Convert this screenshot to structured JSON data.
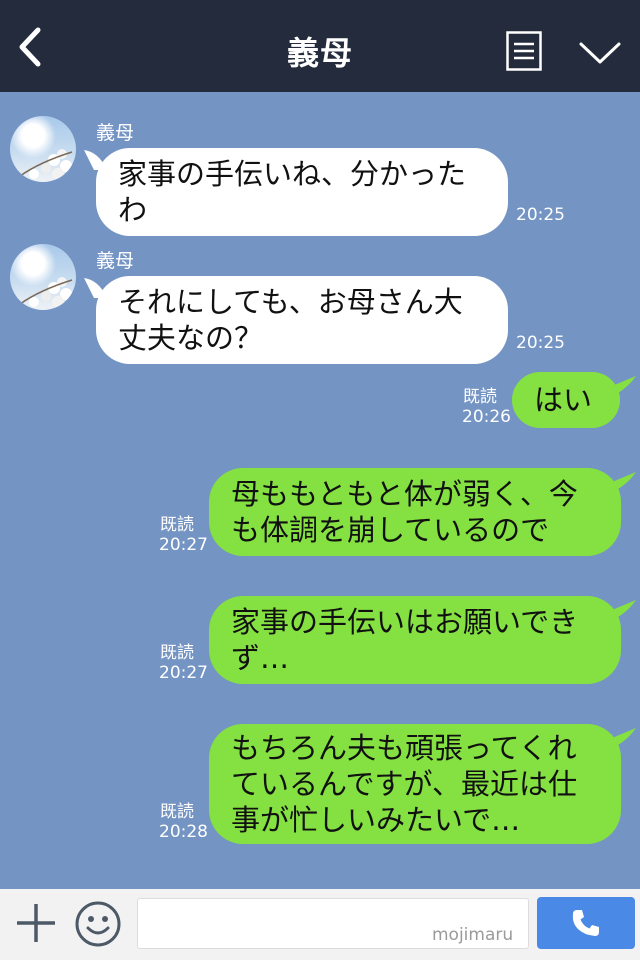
{
  "header": {
    "title": "義母",
    "back_icon": "chevron-left-icon",
    "menu_icon": "list-icon",
    "expand_icon": "chevron-down-icon",
    "background": "#232b3d"
  },
  "chat": {
    "background": "#7494c4",
    "messages": [
      {
        "direction": "in",
        "sender": "義母",
        "text": "家事の手伝いね、分かった\nわ",
        "time": "20:25"
      },
      {
        "direction": "in",
        "sender": "義母",
        "text": "それにしても、お母さん大\n丈夫なの？",
        "time": "20:25"
      },
      {
        "direction": "out",
        "read": "既読",
        "text": "はい",
        "time": "20:26"
      },
      {
        "direction": "out",
        "read": "既読",
        "text": "母ももともと体が弱く、今\nも体調を崩しているので",
        "time": "20:27"
      },
      {
        "direction": "out",
        "read": "既読",
        "text": "家事の手伝いはお願いでき\nず…",
        "time": "20:27"
      },
      {
        "direction": "out",
        "read": "既読",
        "text": "もちろん夫も頑張ってくれ\nているんですが、最近は仕\n事が忙しいみたいで…",
        "time": "20:28"
      }
    ],
    "incoming_color": "#ffffff",
    "outgoing_color": "#84e141"
  },
  "input_bar": {
    "plus_icon": "plus-icon",
    "emoji_icon": "smiley-icon",
    "placeholder": "",
    "watermark": "mojimaru",
    "call_icon": "phone-icon",
    "call_color": "#4a89e6"
  }
}
